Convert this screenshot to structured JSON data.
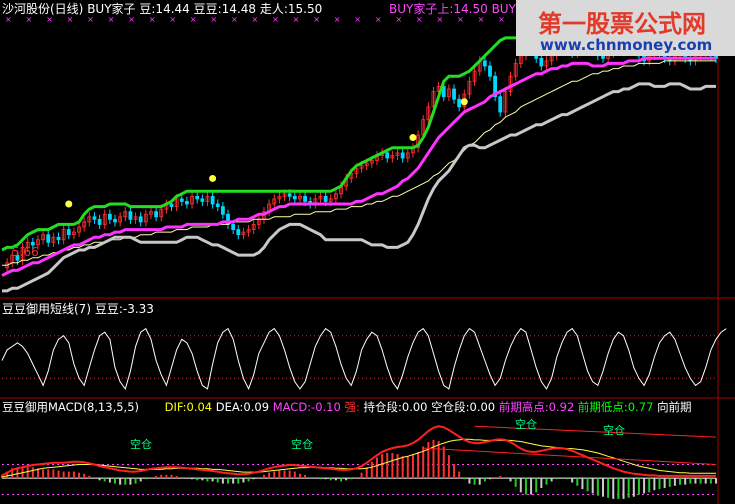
{
  "main_panel": {
    "header": [
      {
        "text": "沙河股份(日线)",
        "color": "#ffffff"
      },
      {
        "text": "BUY家子",
        "color": "#ffffff"
      },
      {
        "text": "豆:14.44",
        "color": "#ffffff"
      },
      {
        "text": "豆豆:14.48",
        "color": "#ffffff"
      },
      {
        "text": "走人:15.50",
        "color": "#ffffff"
      },
      {
        "text": "BUY家子上:14.50",
        "color": "#ff44ff"
      },
      {
        "text": "BUY家",
        "color": "#ff44ff"
      }
    ],
    "low_label": "5.66"
  },
  "watermark": {
    "line1": "第一股票公式网",
    "line2": "www.chnmoney.com"
  },
  "osc_panel": {
    "header": [
      {
        "text": "豆豆御用短线(7)",
        "color": "#ffffff"
      },
      {
        "text": "豆豆:-3.33",
        "color": "#ffffff"
      }
    ]
  },
  "macd_panel": {
    "header": [
      {
        "text": "豆豆御用MACD(8,13,5,5)",
        "color": "#ffffff"
      },
      {
        "text": "DIF:0.04",
        "color": "#ffff00"
      },
      {
        "text": "DEA:0.09",
        "color": "#ffffff"
      },
      {
        "text": "MACD:-0.10",
        "color": "#ff44ff"
      },
      {
        "text": "强:",
        "color": "#ff3030"
      },
      {
        "text": "持仓段:0.00",
        "color": "#ffffff"
      },
      {
        "text": "空仓段:0.00",
        "color": "#ffffff"
      },
      {
        "text": "前期高点:0.92",
        "color": "#ff44ff"
      },
      {
        "text": "前期低点:0.77",
        "color": "#00ff00"
      },
      {
        "text": "向前期",
        "color": "#ffffff"
      }
    ],
    "signal_text": "空仓"
  },
  "colors": {
    "upper_band": "#22dd22",
    "lower_band": "#c8c8c8",
    "mid_line": "#ff33ff",
    "ma_line": "#ffffaa",
    "candle_up": "#ff3030",
    "candle_down": "#00d8ff",
    "axis_red": "#aa0000",
    "dotted": "#cc3333"
  },
  "chart_data": {
    "type": "line",
    "x_count": 140,
    "price_ylim": [
      5.0,
      15.8
    ],
    "series": [
      {
        "values": [
          6.8,
          6.9,
          6.9,
          7.0,
          7.2,
          7.4,
          7.5,
          7.6,
          7.6,
          7.6,
          7.7,
          7.8,
          7.8,
          7.8,
          7.8,
          7.9,
          8.2,
          8.4,
          8.5,
          8.5,
          8.5,
          8.6,
          8.6,
          8.6,
          8.6,
          8.5,
          8.5,
          8.5,
          8.5,
          8.5,
          8.5,
          8.5,
          8.6,
          8.7,
          8.9,
          9.0,
          9.1,
          9.1,
          9.1,
          9.1,
          9.1,
          9.1,
          9.1,
          9.1,
          9.1,
          9.1,
          9.1,
          9.1,
          9.1,
          9.1,
          9.1,
          9.1,
          9.1,
          9.1,
          9.1,
          9.1,
          9.1,
          9.1,
          9.1,
          9.1,
          9.1,
          9.1,
          9.1,
          9.1,
          9.1,
          9.2,
          9.3,
          9.6,
          9.9,
          10.1,
          10.2,
          10.3,
          10.4,
          10.5,
          10.6,
          10.7,
          10.8,
          10.8,
          10.8,
          10.8,
          10.8,
          10.9,
          11.2,
          11.6,
          12.2,
          12.8,
          13.4,
          13.6,
          13.6,
          13.6,
          13.7,
          13.8,
          14.0,
          14.2,
          14.4,
          14.6,
          14.8,
          15.0,
          15.1,
          15.1,
          15.1,
          15.1,
          15.1,
          15.0,
          14.9,
          14.8,
          14.8,
          14.8,
          14.8,
          14.9,
          15.0,
          15.1,
          15.1,
          15.1,
          15.0,
          15.0,
          15.0,
          15.0,
          15.0,
          14.9,
          14.9,
          14.8,
          14.7,
          14.7,
          14.7,
          14.6,
          14.6,
          14.6,
          14.5,
          14.5,
          14.5,
          14.5,
          14.5,
          14.5,
          14.5,
          14.5,
          14.5,
          14.5,
          14.5,
          14.5
        ]
      },
      {
        "values": [
          5.2,
          5.2,
          5.3,
          5.3,
          5.4,
          5.5,
          5.6,
          5.7,
          5.8,
          5.9,
          6.1,
          6.3,
          6.5,
          6.6,
          6.7,
          6.8,
          6.8,
          6.9,
          6.9,
          7.0,
          7.1,
          7.2,
          7.3,
          7.3,
          7.3,
          7.3,
          7.2,
          7.1,
          7.1,
          7.1,
          7.1,
          7.1,
          7.1,
          7.1,
          7.1,
          7.2,
          7.3,
          7.3,
          7.3,
          7.2,
          7.1,
          7.0,
          7.0,
          6.9,
          6.8,
          6.7,
          6.6,
          6.6,
          6.6,
          6.6,
          6.7,
          6.9,
          7.2,
          7.4,
          7.6,
          7.7,
          7.8,
          7.8,
          7.8,
          7.7,
          7.6,
          7.5,
          7.4,
          7.2,
          7.2,
          7.2,
          7.2,
          7.2,
          7.2,
          7.2,
          7.2,
          7.1,
          7.0,
          7.0,
          7.0,
          6.9,
          6.9,
          6.9,
          7.0,
          7.1,
          7.4,
          7.8,
          8.3,
          8.8,
          9.2,
          9.5,
          9.7,
          9.9,
          10.2,
          10.5,
          10.8,
          10.9,
          10.9,
          10.8,
          10.8,
          10.9,
          11.0,
          11.1,
          11.2,
          11.3,
          11.3,
          11.4,
          11.5,
          11.6,
          11.7,
          11.7,
          11.8,
          11.9,
          12.0,
          12.1,
          12.1,
          12.2,
          12.3,
          12.4,
          12.5,
          12.6,
          12.7,
          12.8,
          12.9,
          13.0,
          13.0,
          13.1,
          13.1,
          13.2,
          13.3,
          13.3,
          13.3,
          13.2,
          13.2,
          13.2,
          13.3,
          13.3,
          13.3,
          13.2,
          13.1,
          13.1,
          13.1,
          13.2,
          13.2,
          13.2
        ]
      },
      {
        "values": [
          5.8,
          5.9,
          6.0,
          6.0,
          6.1,
          6.2,
          6.3,
          6.3,
          6.4,
          6.5,
          6.6,
          6.7,
          6.8,
          6.9,
          7.0,
          7.0,
          7.1,
          7.2,
          7.3,
          7.3,
          7.4,
          7.4,
          7.5,
          7.5,
          7.6,
          7.6,
          7.6,
          7.6,
          7.6,
          7.6,
          7.6,
          7.6,
          7.7,
          7.7,
          7.7,
          7.7,
          7.8,
          7.8,
          7.8,
          7.8,
          7.8,
          7.8,
          7.8,
          7.9,
          7.9,
          7.9,
          8.0,
          8.0,
          8.0,
          8.1,
          8.2,
          8.2,
          8.3,
          8.4,
          8.5,
          8.5,
          8.6,
          8.6,
          8.6,
          8.6,
          8.6,
          8.6,
          8.6,
          8.6,
          8.6,
          8.6,
          8.6,
          8.6,
          8.6,
          8.7,
          8.7,
          8.8,
          8.9,
          9.0,
          9.0,
          9.1,
          9.2,
          9.3,
          9.5,
          9.6,
          9.8,
          10.0,
          10.3,
          10.6,
          10.9,
          11.2,
          11.4,
          11.6,
          11.8,
          12.0,
          12.2,
          12.3,
          12.4,
          12.5,
          12.6,
          12.8,
          12.9,
          13.0,
          13.1,
          13.2,
          13.3,
          13.4,
          13.5,
          13.6,
          13.7,
          13.7,
          13.8,
          13.9,
          13.9,
          14.0,
          14.0,
          14.1,
          14.1,
          14.1,
          14.1,
          14.0,
          14.0,
          14.0,
          14.1,
          14.1,
          14.1,
          14.1,
          14.2,
          14.2,
          14.2,
          14.3,
          14.3,
          14.3,
          14.3,
          14.3,
          14.3,
          14.3,
          14.3,
          14.3,
          14.3,
          14.3,
          14.3,
          14.3,
          14.3,
          14.3
        ]
      },
      {
        "values": [
          6.2,
          6.2,
          6.3,
          6.3,
          6.4,
          6.4,
          6.5,
          6.5,
          6.6,
          6.6,
          6.7,
          6.7,
          6.8,
          6.8,
          6.9,
          6.9,
          7.0,
          7.0,
          7.1,
          7.1,
          7.1,
          7.2,
          7.2,
          7.2,
          7.3,
          7.3,
          7.3,
          7.4,
          7.4,
          7.4,
          7.5,
          7.5,
          7.5,
          7.5,
          7.6,
          7.6,
          7.6,
          7.7,
          7.7,
          7.7,
          7.7,
          7.8,
          7.8,
          7.8,
          7.8,
          7.9,
          7.9,
          7.9,
          7.9,
          8.0,
          8.0,
          8.0,
          8.0,
          8.1,
          8.1,
          8.1,
          8.1,
          8.2,
          8.2,
          8.2,
          8.2,
          8.3,
          8.3,
          8.3,
          8.3,
          8.4,
          8.4,
          8.4,
          8.5,
          8.5,
          8.5,
          8.6,
          8.6,
          8.7,
          8.7,
          8.8,
          8.9,
          8.9,
          9.0,
          9.1,
          9.2,
          9.3,
          9.4,
          9.5,
          9.7,
          9.8,
          10.0,
          10.2,
          10.3,
          10.5,
          10.7,
          10.9,
          11.0,
          11.2,
          11.4,
          11.5,
          11.7,
          11.8,
          12.0,
          12.1,
          12.2,
          12.4,
          12.5,
          12.6,
          12.7,
          12.8,
          12.9,
          13.0,
          13.1,
          13.2,
          13.3,
          13.4,
          13.4,
          13.5,
          13.6,
          13.7,
          13.7,
          13.8,
          13.8,
          13.9,
          13.9,
          14.0,
          14.0,
          14.0,
          14.1,
          14.1,
          14.1,
          14.1,
          14.1,
          14.2,
          14.2,
          14.2,
          14.2,
          14.2,
          14.2,
          14.2,
          14.2,
          14.2,
          14.2,
          14.2
        ]
      },
      {
        "values": [
          6.1,
          6.3,
          6.6,
          6.4,
          6.9,
          7.1,
          7.0,
          7.2,
          7.4,
          7.1,
          7.3,
          7.2,
          7.6,
          7.4,
          7.5,
          7.7,
          7.9,
          8.1,
          8.0,
          7.8,
          8.2,
          8.0,
          7.9,
          8.1,
          8.3,
          8.0,
          8.1,
          7.9,
          8.2,
          8.3,
          8.1,
          8.4,
          8.6,
          8.5,
          8.8,
          8.7,
          8.6,
          8.9,
          8.8,
          8.7,
          8.9,
          8.6,
          8.5,
          8.2,
          7.8,
          7.6,
          7.4,
          7.5,
          7.6,
          7.8,
          8.0,
          8.3,
          8.6,
          8.8,
          8.9,
          9.0,
          8.9,
          8.8,
          8.9,
          8.7,
          8.6,
          8.8,
          8.9,
          8.7,
          8.8,
          9.0,
          9.3,
          9.6,
          9.8,
          10.0,
          10.1,
          10.2,
          10.3,
          10.5,
          10.6,
          10.4,
          10.5,
          10.6,
          10.4,
          10.6,
          10.8,
          11.3,
          11.9,
          12.4,
          13.0,
          13.2,
          12.8,
          13.1,
          12.7,
          12.4,
          12.9,
          13.4,
          13.8,
          14.2,
          14.0,
          13.6,
          12.8,
          12.2,
          13.0,
          13.6,
          14.1,
          14.4,
          14.6,
          14.7,
          14.3,
          14.0,
          14.2,
          14.4,
          14.6,
          14.8,
          14.6,
          14.5,
          14.7,
          14.9,
          14.8,
          14.6,
          14.4,
          14.3,
          14.5,
          14.7,
          14.6,
          14.8,
          14.7,
          14.6,
          14.4,
          14.2,
          14.4,
          14.6,
          14.5,
          14.3,
          14.2,
          14.4,
          14.5,
          14.3,
          14.2,
          14.4,
          14.5,
          14.6,
          14.4,
          14.3
        ]
      }
    ],
    "osc_series": [
      {
        "values": [
          -1,
          2,
          3,
          4,
          3,
          1,
          -2,
          -5,
          -8,
          -4,
          2,
          5,
          6,
          4,
          -2,
          -6,
          -8,
          -3,
          2,
          6,
          7,
          5,
          -3,
          -7,
          -9,
          -4,
          3,
          7,
          8,
          5,
          -1,
          -5,
          -8,
          -3,
          2,
          5,
          4,
          1,
          -4,
          -8,
          -9,
          -2,
          4,
          7,
          8,
          5,
          -1,
          -6,
          -9,
          -5,
          1,
          4,
          7,
          8,
          6,
          2,
          -3,
          -7,
          -9,
          -7,
          -2,
          3,
          6,
          8,
          7,
          3,
          -2,
          -6,
          -8,
          -4,
          2,
          5,
          7,
          6,
          2,
          -3,
          -7,
          -9,
          -5,
          0,
          4,
          7,
          8,
          6,
          1,
          -4,
          -8,
          -9,
          -3,
          2,
          6,
          8,
          7,
          3,
          -1,
          -5,
          -8,
          -6,
          -1,
          3,
          6,
          8,
          7,
          2,
          -3,
          -7,
          -9,
          -6,
          0,
          4,
          7,
          8,
          6,
          1,
          -4,
          -7,
          -8,
          -4,
          1,
          5,
          7,
          6,
          2,
          -3,
          -6,
          -8,
          -5,
          0,
          4,
          6,
          7,
          5,
          1,
          -3,
          -6,
          -8,
          -7,
          -3,
          2,
          5,
          7,
          8
        ]
      }
    ],
    "macd_series": [
      {
        "name": "DIF",
        "values": [
          0.05,
          0.1,
          0.15,
          0.18,
          0.2,
          0.22,
          0.24,
          0.25,
          0.26,
          0.27,
          0.28,
          0.28,
          0.28,
          0.29,
          0.3,
          0.3,
          0.29,
          0.27,
          0.25,
          0.22,
          0.2,
          0.18,
          0.16,
          0.14,
          0.13,
          0.12,
          0.12,
          0.13,
          0.15,
          0.17,
          0.18,
          0.19,
          0.2,
          0.2,
          0.2,
          0.19,
          0.18,
          0.17,
          0.16,
          0.15,
          0.14,
          0.13,
          0.12,
          0.1,
          0.09,
          0.08,
          0.07,
          0.07,
          0.08,
          0.1,
          0.12,
          0.15,
          0.18,
          0.2,
          0.22,
          0.23,
          0.24,
          0.24,
          0.23,
          0.22,
          0.21,
          0.2,
          0.19,
          0.18,
          0.17,
          0.16,
          0.15,
          0.15,
          0.16,
          0.18,
          0.22,
          0.28,
          0.35,
          0.42,
          0.48,
          0.52,
          0.55,
          0.57,
          0.58,
          0.6,
          0.64,
          0.7,
          0.78,
          0.86,
          0.92,
          0.95,
          0.93,
          0.88,
          0.82,
          0.76,
          0.7,
          0.66,
          0.64,
          0.64,
          0.66,
          0.68,
          0.7,
          0.71,
          0.7,
          0.66,
          0.6,
          0.54,
          0.5,
          0.48,
          0.48,
          0.5,
          0.52,
          0.54,
          0.55,
          0.55,
          0.53,
          0.5,
          0.46,
          0.42,
          0.38,
          0.34,
          0.3,
          0.26,
          0.22,
          0.18,
          0.15,
          0.12,
          0.1,
          0.08,
          0.07,
          0.06,
          0.05,
          0.05,
          0.04,
          0.04,
          0.04,
          0.04,
          0.04,
          0.04,
          0.04,
          0.04,
          0.04,
          0.04,
          0.04,
          0.04
        ]
      },
      {
        "name": "DEA",
        "values": [
          0.02,
          0.04,
          0.06,
          0.08,
          0.1,
          0.12,
          0.14,
          0.16,
          0.18,
          0.19,
          0.2,
          0.21,
          0.22,
          0.23,
          0.24,
          0.25,
          0.25,
          0.25,
          0.25,
          0.24,
          0.23,
          0.22,
          0.21,
          0.2,
          0.19,
          0.18,
          0.17,
          0.16,
          0.16,
          0.16,
          0.16,
          0.16,
          0.17,
          0.17,
          0.18,
          0.18,
          0.18,
          0.18,
          0.18,
          0.17,
          0.17,
          0.16,
          0.16,
          0.15,
          0.14,
          0.13,
          0.12,
          0.11,
          0.11,
          0.11,
          0.11,
          0.12,
          0.13,
          0.14,
          0.15,
          0.16,
          0.17,
          0.18,
          0.19,
          0.19,
          0.2,
          0.2,
          0.2,
          0.19,
          0.19,
          0.18,
          0.18,
          0.17,
          0.17,
          0.17,
          0.17,
          0.18,
          0.2,
          0.23,
          0.26,
          0.29,
          0.32,
          0.35,
          0.38,
          0.4,
          0.43,
          0.46,
          0.49,
          0.53,
          0.57,
          0.61,
          0.64,
          0.67,
          0.69,
          0.7,
          0.71,
          0.71,
          0.7,
          0.7,
          0.69,
          0.69,
          0.69,
          0.69,
          0.69,
          0.69,
          0.68,
          0.67,
          0.65,
          0.63,
          0.61,
          0.59,
          0.58,
          0.57,
          0.56,
          0.55,
          0.54,
          0.54,
          0.53,
          0.52,
          0.5,
          0.48,
          0.46,
          0.43,
          0.4,
          0.37,
          0.34,
          0.31,
          0.28,
          0.25,
          0.22,
          0.2,
          0.18,
          0.16,
          0.14,
          0.13,
          0.12,
          0.11,
          0.1,
          0.1,
          0.09,
          0.09,
          0.09,
          0.09,
          0.09,
          0.09
        ]
      }
    ],
    "macd_ylim": [
      -0.4,
      1.1
    ],
    "osc_ylim": [
      -11,
      11
    ]
  }
}
